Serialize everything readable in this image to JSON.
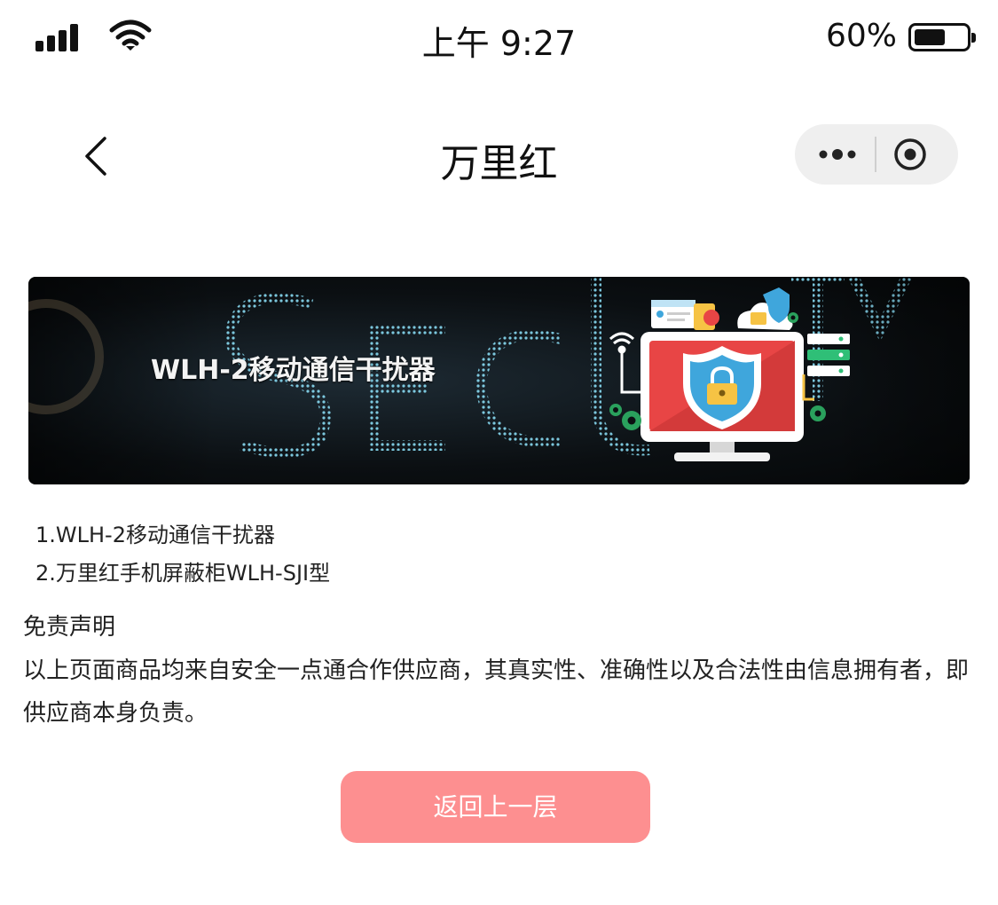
{
  "status_bar": {
    "time": "上午 9:27",
    "battery_percent": "60%",
    "battery_level": 0.6,
    "icons": [
      "signal-icon",
      "wifi-icon",
      "battery-icon"
    ]
  },
  "nav": {
    "title": "万里红",
    "icons": [
      "back-icon",
      "more-icon",
      "target-icon"
    ]
  },
  "banner": {
    "text": "WLH-2移动通信干扰器",
    "background_word": "SECURITY",
    "icons": [
      "shield-lock-icon",
      "monitor-icon",
      "cloud-lock-icon",
      "wifi-icon",
      "server-icon",
      "gear-icon",
      "id-card-icon"
    ]
  },
  "items": [
    "1.WLH-2移动通信干扰器",
    "2.万里红手机屏蔽柜WLH-SJI型"
  ],
  "disclaimer": {
    "title": "免责声明",
    "body": "以上页面商品均来自安全一点通合作供应商，其真实性、准确性以及合法性由信息拥有者，即供应商本身负责。"
  },
  "button": {
    "label": "返回上一层",
    "color": "#fd8f90"
  },
  "colors": {
    "accent": "#fd8f90",
    "shield": "#3fa6dc",
    "monitor": "#e84545"
  }
}
